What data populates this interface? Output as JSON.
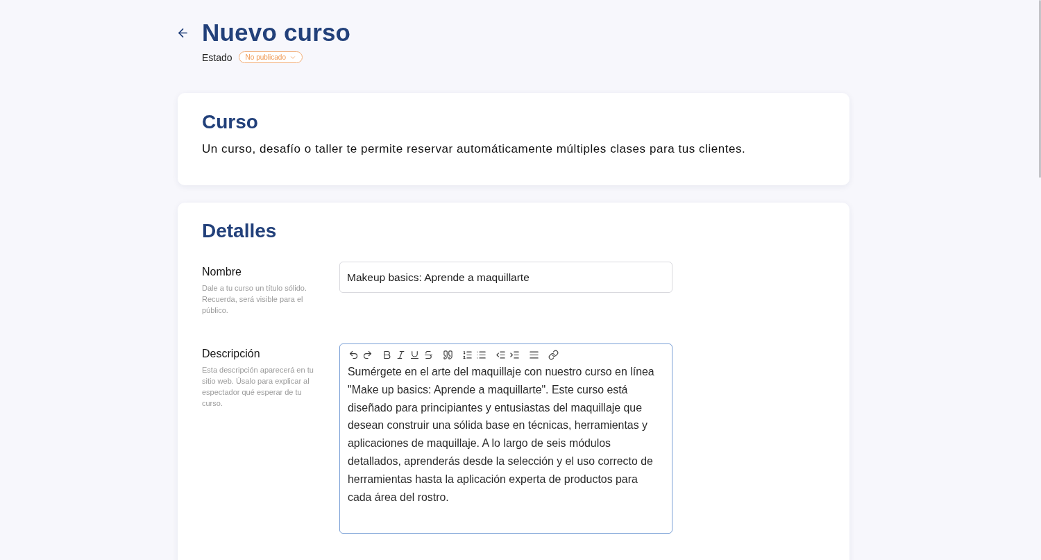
{
  "header": {
    "title": "Nuevo curso",
    "status_label": "Estado",
    "status_value": "No publicado"
  },
  "course_card": {
    "title": "Curso",
    "description": "Un curso, desafío o taller te permite reservar automáticamente múltiples clases para tus clientes."
  },
  "details_card": {
    "title": "Detalles",
    "fields": [
      {
        "kind": "text",
        "label": "Nombre",
        "help": "Dale a tu curso un título sólido. Recuerda, será visible para el público.",
        "value": "Makeup basics: Aprende a maquillarte",
        "focused": false
      },
      {
        "kind": "rich_text",
        "label": "Descripción",
        "help": "Esta descripción aparecerá en tu sitio web. Úsalo para explicar al espectador qué esperar de tu curso.",
        "value": "Sumérgete en el arte del maquillaje con nuestro curso en línea \"Make up basics: Aprende a maquillarte\". Este curso está diseñado para principiantes y entusiastas del maquillaje que desean construir una sólida base en técnicas, herramientas y aplicaciones de maquillaje. A lo largo de seis módulos detallados, aprenderás desde la selección y el uso correcto de herramientas hasta la aplicación experta de productos para cada área del rostro.",
        "focused": true
      }
    ]
  }
}
